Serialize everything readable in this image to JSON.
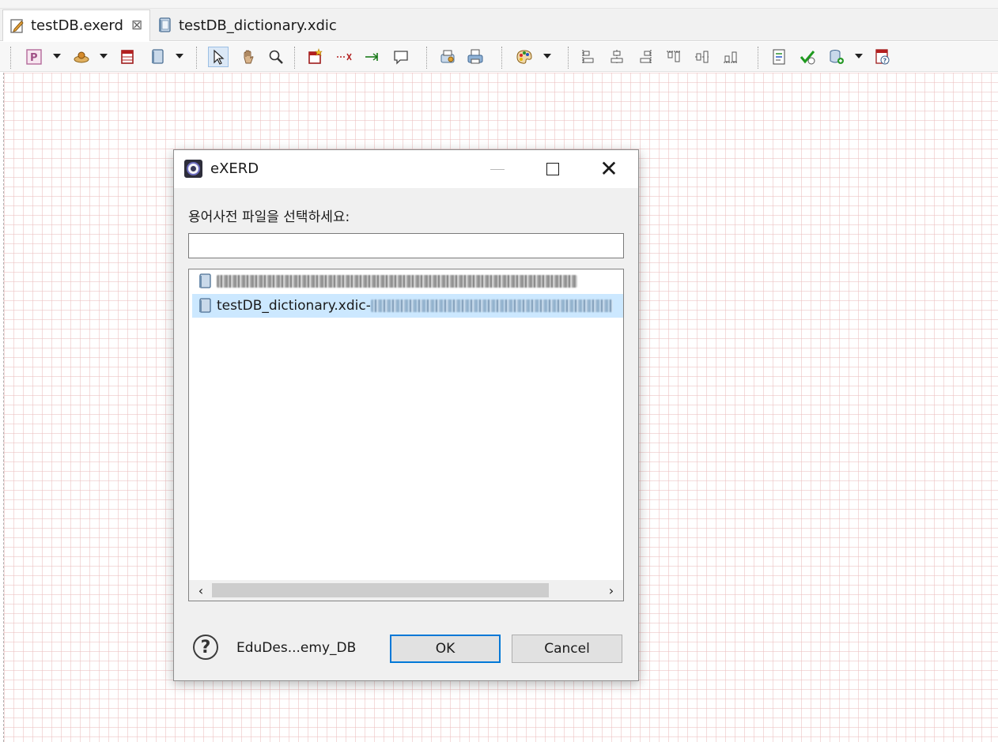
{
  "editor_tabs": [
    {
      "label": "testDB.exerd",
      "active": true,
      "icon": "erd-file-icon",
      "close_glyph": "⊠"
    },
    {
      "label": "testDB_dictionary.xdic",
      "active": false,
      "icon": "dictionary-file-icon"
    }
  ],
  "toolbar": {
    "icons": [
      "property-icon",
      "connection-icon",
      "table-icon",
      "dictionary-icon",
      "select-pointer-icon",
      "hand-pan-icon",
      "zoom-icon",
      "new-table-icon",
      "non-identifying-relation-icon",
      "identifying-relation-icon",
      "note-icon",
      "import-db-icon",
      "print-icon",
      "color-palette-icon",
      "align-left-icon",
      "align-center-icon",
      "align-right-icon",
      "align-top-icon",
      "align-middle-icon",
      "align-bottom-icon",
      "document-icon",
      "validate-check-icon",
      "forward-engineer-icon",
      "help-doc-icon"
    ]
  },
  "dialog": {
    "title": "eXERD",
    "window_controls": {
      "minimize": "—",
      "maximize": "□",
      "close": "✕"
    },
    "prompt": "용어사전 파일을 선택하세요:",
    "filter_value": "",
    "items": [
      {
        "name": "",
        "path": "",
        "selected": false
      },
      {
        "name": "testDB_dictionary.xdic",
        "separator": " - ",
        "path": "",
        "selected": true
      }
    ],
    "scroll_left": "‹",
    "scroll_right": "›",
    "help_glyph": "?",
    "footer_label": "EduDes...emy_DB",
    "ok_label": "OK",
    "cancel_label": "Cancel"
  },
  "colors": {
    "selection": "#cce8ff",
    "default_button_border": "#0078d7",
    "grid_line": "#ebbebe"
  }
}
